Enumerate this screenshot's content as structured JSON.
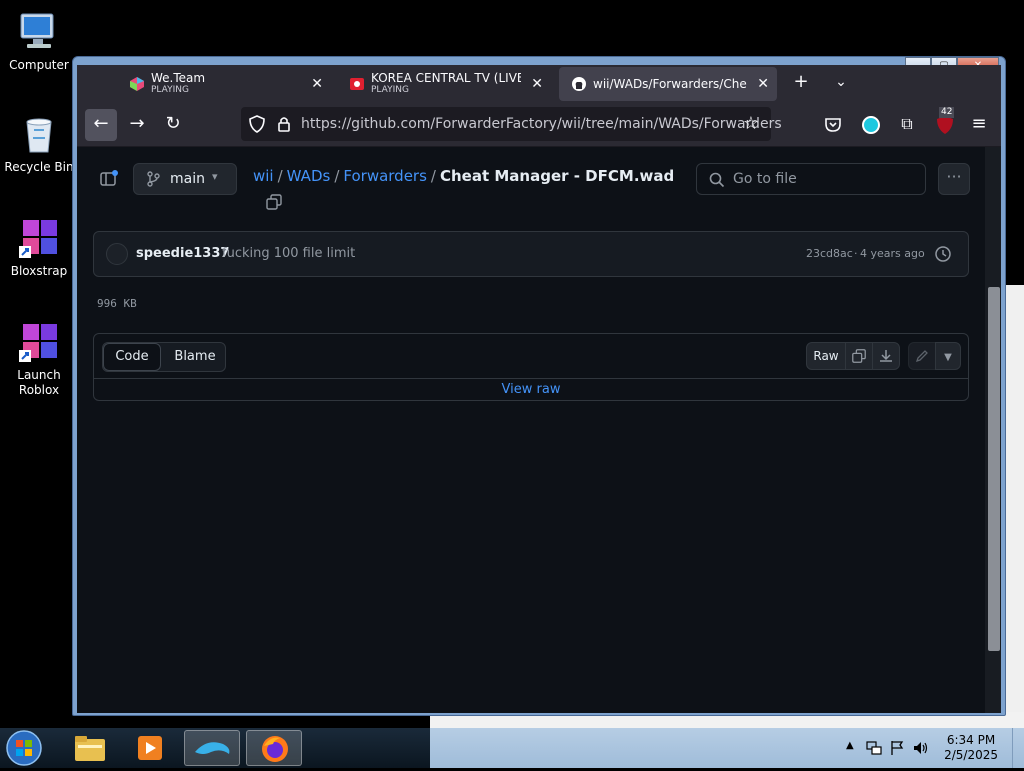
{
  "desktop": {
    "icons": [
      {
        "label": "Computer"
      },
      {
        "label": "Recycle Bin"
      },
      {
        "label": "Bloxstrap"
      },
      {
        "label": "Launch Roblox"
      }
    ]
  },
  "browser": {
    "tabs": [
      {
        "title": "We.Team",
        "status": "PLAYING"
      },
      {
        "title": "KOREA CENTRAL TV (LIVESTRE",
        "status": "PLAYING"
      },
      {
        "title": "wii/WADs/Forwarders/Cheat M"
      }
    ],
    "url": "https://github.com/ForwarderFactory/wii/tree/main/WADs/Forwarders",
    "extension_badge": "42"
  },
  "page": {
    "branch": "main",
    "breadcrumb": {
      "repo": "wii",
      "dir1": "WADs",
      "dir2": "Forwarders",
      "sep": "/",
      "file": "Cheat Manager - DFCM.wad"
    },
    "search_placeholder": "Go to file",
    "commit": {
      "author": "speedie1337",
      "message": "fucking 100 file limit",
      "sha": "23cd8ac",
      "time": "4 years ago",
      "dot": "·"
    },
    "file_size": "996 KB",
    "tabs": {
      "code": "Code",
      "blame": "Blame"
    },
    "raw_label": "Raw",
    "view_raw": "View raw"
  },
  "taskbar": {
    "time": "6:34 PM",
    "date": "2/5/2025"
  },
  "colors": {
    "accent_link": "#4493f8",
    "bg": "#0d1117",
    "border": "#30363d"
  }
}
